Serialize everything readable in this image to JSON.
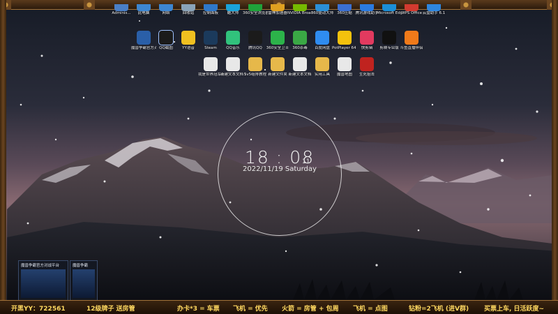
{
  "desktop": {
    "row0": [
      {
        "label": "Adminis...",
        "icon": "user-folder-icon",
        "color": "#4a7fc6"
      },
      {
        "label": "此电脑",
        "icon": "computer-icon",
        "color": "#3d86d1"
      },
      {
        "label": "网络",
        "icon": "network-icon",
        "color": "#3d86d1"
      },
      {
        "label": "回收站",
        "icon": "recycle-bin-icon",
        "color": "#8aa3b8"
      },
      {
        "label": "控制面板",
        "icon": "control-panel-icon",
        "color": "#2f78c9"
      },
      {
        "label": "酷大师",
        "icon": "app-icon",
        "color": "#1aa3d9"
      },
      {
        "label": "360安全浏览器",
        "icon": "browser-icon",
        "color": "#1fa33a"
      },
      {
        "label": "雷神加速器",
        "icon": "accelerator-icon",
        "color": "#e0a020"
      },
      {
        "label": "NVIDIA Broadcast",
        "icon": "nvidia-icon",
        "color": "#76b900"
      },
      {
        "label": "360驱动大师",
        "icon": "driver-icon",
        "color": "#2b8fd6"
      },
      {
        "label": "360压缩",
        "icon": "archive-icon",
        "color": "#3b6fd0"
      },
      {
        "label": "腾讯游戏助手",
        "icon": "game-icon",
        "color": "#2b7be0"
      },
      {
        "label": "Microsoft Edge",
        "icon": "edge-icon",
        "color": "#1c8fd6"
      },
      {
        "label": "WPS Office",
        "icon": "wps-icon",
        "color": "#d23a2f"
      },
      {
        "label": "云盘助手 6.1",
        "icon": "cloud-icon",
        "color": "#2e86de"
      }
    ],
    "row1": [
      {
        "label": "魔兽争霸官方对战平台",
        "icon": "warcraft-icon",
        "color": "#2a5fa8"
      },
      {
        "label": "QQ截图",
        "icon": "qq-icon",
        "color": "#1b1b1b"
      },
      {
        "label": "YY语音",
        "icon": "yy-icon",
        "color": "#f0c020"
      },
      {
        "label": "Steam",
        "icon": "steam-icon",
        "color": "#1b3a5c"
      },
      {
        "label": "QQ音乐",
        "icon": "music-icon",
        "color": "#31c27c"
      },
      {
        "label": "腾讯QQ",
        "icon": "qq-penguin-icon",
        "color": "#1b1b1b"
      },
      {
        "label": "360安全卫士",
        "icon": "security-icon",
        "color": "#2cb34a"
      },
      {
        "label": "360杀毒",
        "icon": "shield-icon",
        "color": "#3aa845"
      },
      {
        "label": "百度网盘",
        "icon": "baidu-disk-icon",
        "color": "#2f8cf0"
      },
      {
        "label": "PotPlayer 64 bit",
        "icon": "player-icon",
        "color": "#f4c20d"
      },
      {
        "label": "快剪辑",
        "icon": "video-edit-icon",
        "color": "#e23a5f"
      },
      {
        "label": "剪映专业版",
        "icon": "capcut-icon",
        "color": "#111111"
      },
      {
        "label": "斗鱼直播伴侣",
        "icon": "live-icon",
        "color": "#f07a1a"
      }
    ],
    "row2": [
      {
        "label": "我是世界冠军平台",
        "icon": "document-icon",
        "color": "#e8e8e8"
      },
      {
        "label": "新建文本文档 (2)",
        "icon": "text-file-icon",
        "color": "#e8e8e8"
      },
      {
        "label": "5v5组排教程",
        "icon": "folder-icon",
        "color": "#e6b84a"
      },
      {
        "label": "新建文件夹",
        "icon": "folder-icon",
        "color": "#e6b84a"
      },
      {
        "label": "新建文本文档",
        "icon": "text-file-icon",
        "color": "#e8e8e8"
      },
      {
        "label": "实用工具",
        "icon": "tools-folder-icon",
        "color": "#e6b84a"
      },
      {
        "label": "魔兽地图",
        "icon": "document-icon",
        "color": "#e8e8e8"
      },
      {
        "label": "生死狙击",
        "icon": "game-logo-icon",
        "color": "#c0231f"
      }
    ]
  },
  "clock": {
    "hour": "18",
    "minute": "08",
    "second": "11",
    "date": "2022/11/19 Saturday"
  },
  "thumbnails": [
    {
      "title": "魔兽争霸官方对战平台"
    },
    {
      "title": "魔兽争霸"
    }
  ],
  "ticker": [
    "开黑YY：722561",
    "12级牌子 送房管",
    "办卡*3 = 车票",
    "飞机 = 优先",
    "火箭 = 房管 + 包周",
    "飞机 = 点图",
    "钻粉=2飞机 (进V群)",
    "买票上车, 日活跃度~"
  ],
  "colors": {
    "ticker_text": "#ffd860",
    "frame": "#a27238"
  }
}
